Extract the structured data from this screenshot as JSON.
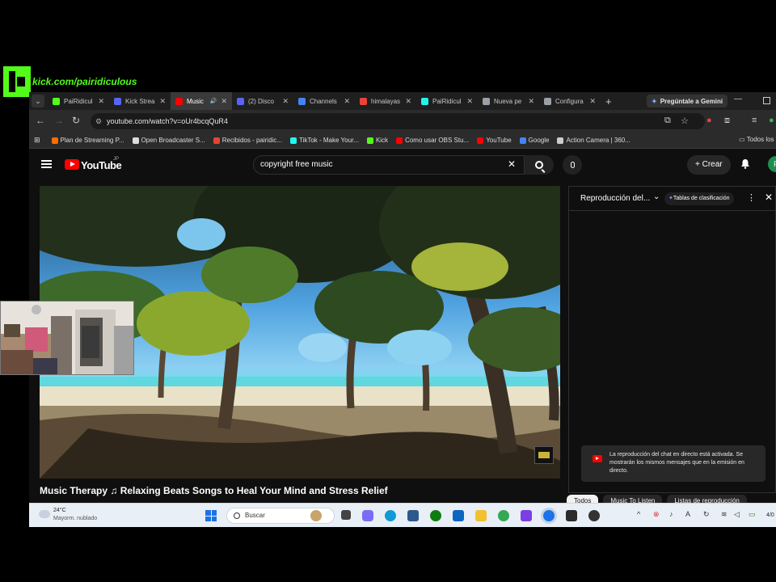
{
  "overlay": {
    "kick_url": "kick.com/pairidiculous"
  },
  "tabs": [
    {
      "title": "PaiRidicul",
      "color": "#53fc18"
    },
    {
      "title": "Kick Strea",
      "color": "#5865f2"
    },
    {
      "title": "Music",
      "color": "#ff0000",
      "active": true
    },
    {
      "title": "(2) Disco",
      "color": "#5865f2"
    },
    {
      "title": "Channels",
      "color": "#4285f4"
    },
    {
      "title": "himalayas",
      "color": "#ea4335"
    },
    {
      "title": "PaiRidicul",
      "color": "#25f4ee"
    },
    {
      "title": "Nueva pe",
      "color": "#9aa0a6"
    },
    {
      "title": "Configura",
      "color": "#9aa0a6"
    }
  ],
  "browser": {
    "gemini_label": "Pregúntale a Gemini",
    "url": "youtube.com/watch?v=oUr4bcqQuR4"
  },
  "bookmarks": [
    {
      "label": "Plan de Streaming P...",
      "color": "#ff6d00"
    },
    {
      "label": "Open Broadcaster S...",
      "color": "#dddddd"
    },
    {
      "label": "Recibidos - pairidic...",
      "color": "#ea4335"
    },
    {
      "label": "TikTok - Make Your...",
      "color": "#25f4ee"
    },
    {
      "label": "Kick",
      "color": "#53fc18"
    },
    {
      "label": "Como usar OBS Stu...",
      "color": "#ff0000"
    },
    {
      "label": "YouTube",
      "color": "#ff0000"
    },
    {
      "label": "Google",
      "color": "#4285f4"
    },
    {
      "label": "Action Camera | 360...",
      "color": "#cccccc"
    }
  ],
  "bookmarks_all": "Todos los f",
  "youtube": {
    "logo_text": "YouTube",
    "country": "JP",
    "search_query": "copyright free music",
    "create_label": "Crear",
    "avatar_letter": "P",
    "video_title": "Music Therapy ♫ Relaxing Beats Songs to Heal Your Mind and Stress Relief"
  },
  "chat": {
    "title": "Reproducción del...",
    "chip": "Tablas de clasificación",
    "notice": "La reproducción del chat en directo está activada. Se mostrarán los mismos mensajes que en la emisión en directo."
  },
  "filter_chips": [
    "Todos",
    "Music To Listen",
    "Listas de reproducción"
  ],
  "taskbar": {
    "temp": "24°C",
    "weather": "Mayorm. nublado",
    "search_placeholder": "Buscar",
    "time": "4/0"
  }
}
